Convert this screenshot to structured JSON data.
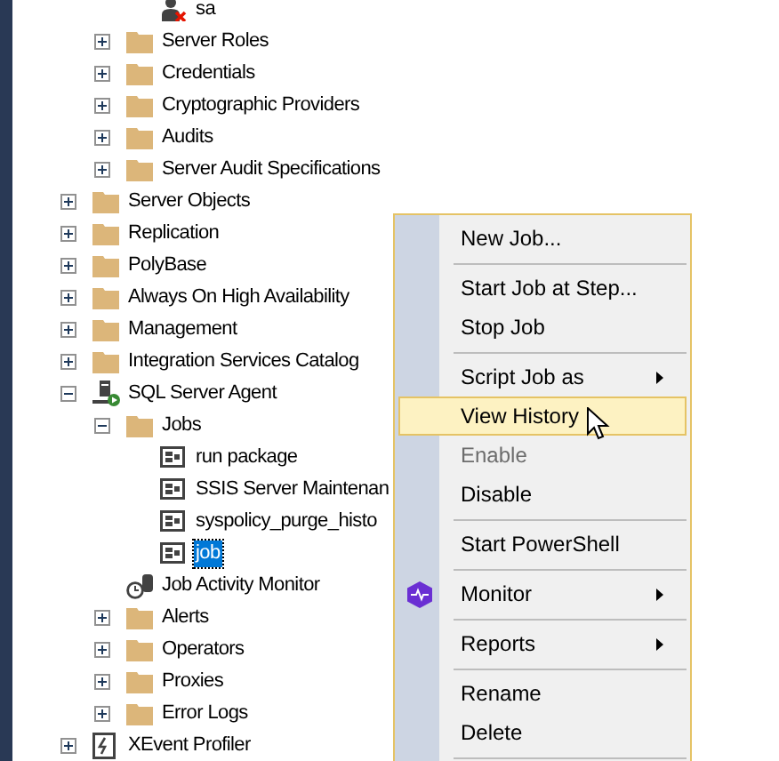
{
  "tree": {
    "logins_tail": [
      {
        "label": "sa",
        "kind": "login"
      }
    ],
    "security_tail": [
      {
        "label": "Server Roles",
        "kind": "folder",
        "expanded": false
      },
      {
        "label": "Credentials",
        "kind": "folder",
        "expanded": false
      },
      {
        "label": "Cryptographic Providers",
        "kind": "folder",
        "expanded": false
      },
      {
        "label": "Audits",
        "kind": "folder",
        "expanded": false
      },
      {
        "label": "Server Audit Specifications",
        "kind": "folder",
        "expanded": false
      }
    ],
    "items": [
      {
        "label": "Server Objects",
        "kind": "folder",
        "expanded": false
      },
      {
        "label": "Replication",
        "kind": "folder",
        "expanded": false
      },
      {
        "label": "PolyBase",
        "kind": "folder",
        "expanded": false
      },
      {
        "label": "Always On High Availability",
        "kind": "folder",
        "expanded": false
      },
      {
        "label": "Management",
        "kind": "folder",
        "expanded": false
      },
      {
        "label": "Integration Services Catalog",
        "kind": "folder",
        "expanded": false
      },
      {
        "label": "SQL Server Agent",
        "kind": "agent",
        "expanded": true,
        "children": [
          {
            "label": "Jobs",
            "kind": "folder",
            "expanded": true,
            "children": [
              {
                "label": "run package",
                "kind": "job",
                "selected": false
              },
              {
                "label": "SSIS Server Maintenan",
                "kind": "job",
                "selected": false
              },
              {
                "label": "syspolicy_purge_histo",
                "kind": "job",
                "selected": false
              },
              {
                "label": "job",
                "kind": "job",
                "selected": true
              }
            ]
          },
          {
            "label": "Job Activity Monitor",
            "kind": "monitor"
          },
          {
            "label": "Alerts",
            "kind": "folder",
            "expanded": false
          },
          {
            "label": "Operators",
            "kind": "folder",
            "expanded": false
          },
          {
            "label": "Proxies",
            "kind": "folder",
            "expanded": false
          },
          {
            "label": "Error Logs",
            "kind": "folder",
            "expanded": false
          }
        ]
      },
      {
        "label": "XEvent Profiler",
        "kind": "profiler",
        "expanded": false
      }
    ]
  },
  "context_menu": [
    {
      "kind": "item",
      "label": "New Job..."
    },
    {
      "kind": "separator"
    },
    {
      "kind": "item",
      "label": "Start Job at Step..."
    },
    {
      "kind": "item",
      "label": "Stop Job"
    },
    {
      "kind": "separator"
    },
    {
      "kind": "item",
      "label": "Script Job as",
      "submenu": true
    },
    {
      "kind": "item",
      "label": "View History",
      "selected": true
    },
    {
      "kind": "item",
      "label": "Enable",
      "disabled": true
    },
    {
      "kind": "item",
      "label": "Disable"
    },
    {
      "kind": "separator"
    },
    {
      "kind": "item",
      "label": "Start PowerShell"
    },
    {
      "kind": "separator"
    },
    {
      "kind": "icon_item",
      "label": "Monitor",
      "submenu": true
    },
    {
      "kind": "separator"
    },
    {
      "kind": "item",
      "label": "Reports",
      "submenu": true
    },
    {
      "kind": "separator"
    },
    {
      "kind": "item",
      "label": "Rename"
    },
    {
      "kind": "item",
      "label": "Delete"
    },
    {
      "kind": "separator"
    }
  ]
}
